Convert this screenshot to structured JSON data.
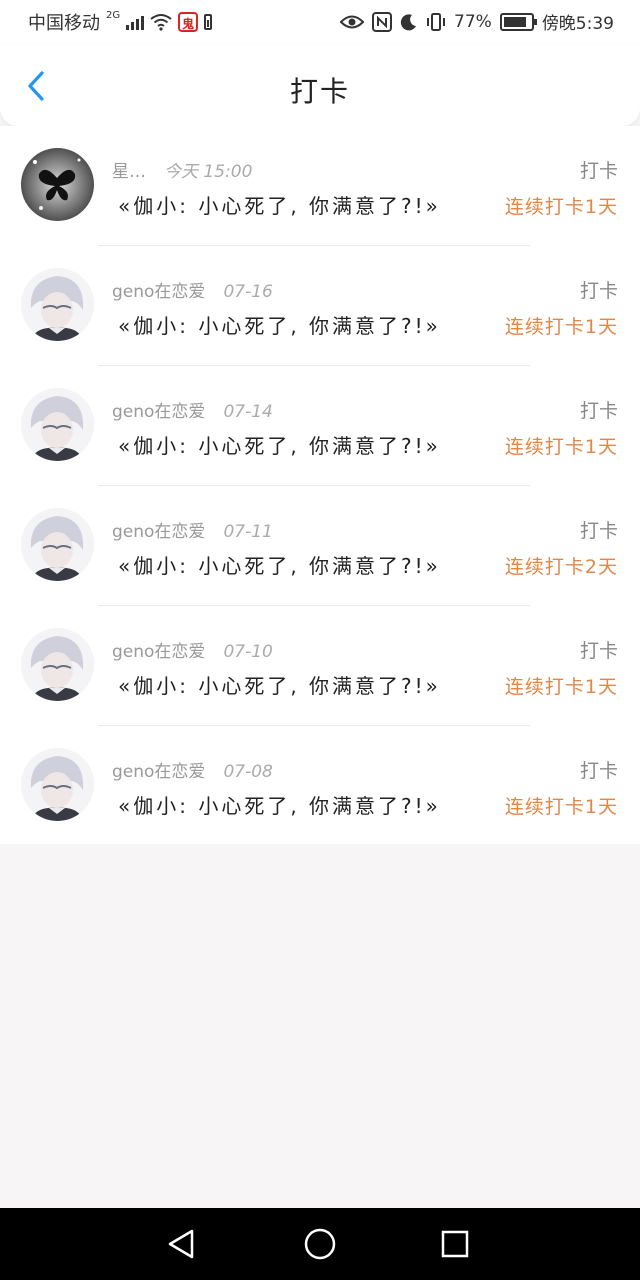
{
  "status_bar": {
    "carrier": "中国移动",
    "network": "2G",
    "battery_percent": "77%",
    "time": "傍晚5:39"
  },
  "header": {
    "title": "打卡"
  },
  "items": [
    {
      "user": "星…",
      "time": "今天 15:00",
      "kind": "打卡",
      "message": "«伽小: 小心死了, 你满意了?!»",
      "streak": "连续打卡1天",
      "avatar": "butterfly-avatar"
    },
    {
      "user": "geno在恋爱",
      "time": "07-16",
      "kind": "打卡",
      "message": "«伽小: 小心死了, 你满意了?!»",
      "streak": "连续打卡1天",
      "avatar": "anime-boy-avatar"
    },
    {
      "user": "geno在恋爱",
      "time": "07-14",
      "kind": "打卡",
      "message": "«伽小: 小心死了, 你满意了?!»",
      "streak": "连续打卡1天",
      "avatar": "anime-boy-avatar"
    },
    {
      "user": "geno在恋爱",
      "time": "07-11",
      "kind": "打卡",
      "message": "«伽小: 小心死了, 你满意了?!»",
      "streak": "连续打卡2天",
      "avatar": "anime-boy-avatar"
    },
    {
      "user": "geno在恋爱",
      "time": "07-10",
      "kind": "打卡",
      "message": "«伽小: 小心死了, 你满意了?!»",
      "streak": "连续打卡1天",
      "avatar": "anime-boy-avatar"
    },
    {
      "user": "geno在恋爱",
      "time": "07-08",
      "kind": "打卡",
      "message": "«伽小: 小心死了, 你满意了?!»",
      "streak": "连续打卡1天",
      "avatar": "anime-boy-avatar"
    }
  ],
  "colors": {
    "accent": "#2196f3",
    "streak": "#e0874a",
    "background": "#f7f5f6"
  },
  "nav": {
    "back": "back-triangle-icon",
    "home": "home-circle-icon",
    "recents": "recents-square-icon"
  }
}
